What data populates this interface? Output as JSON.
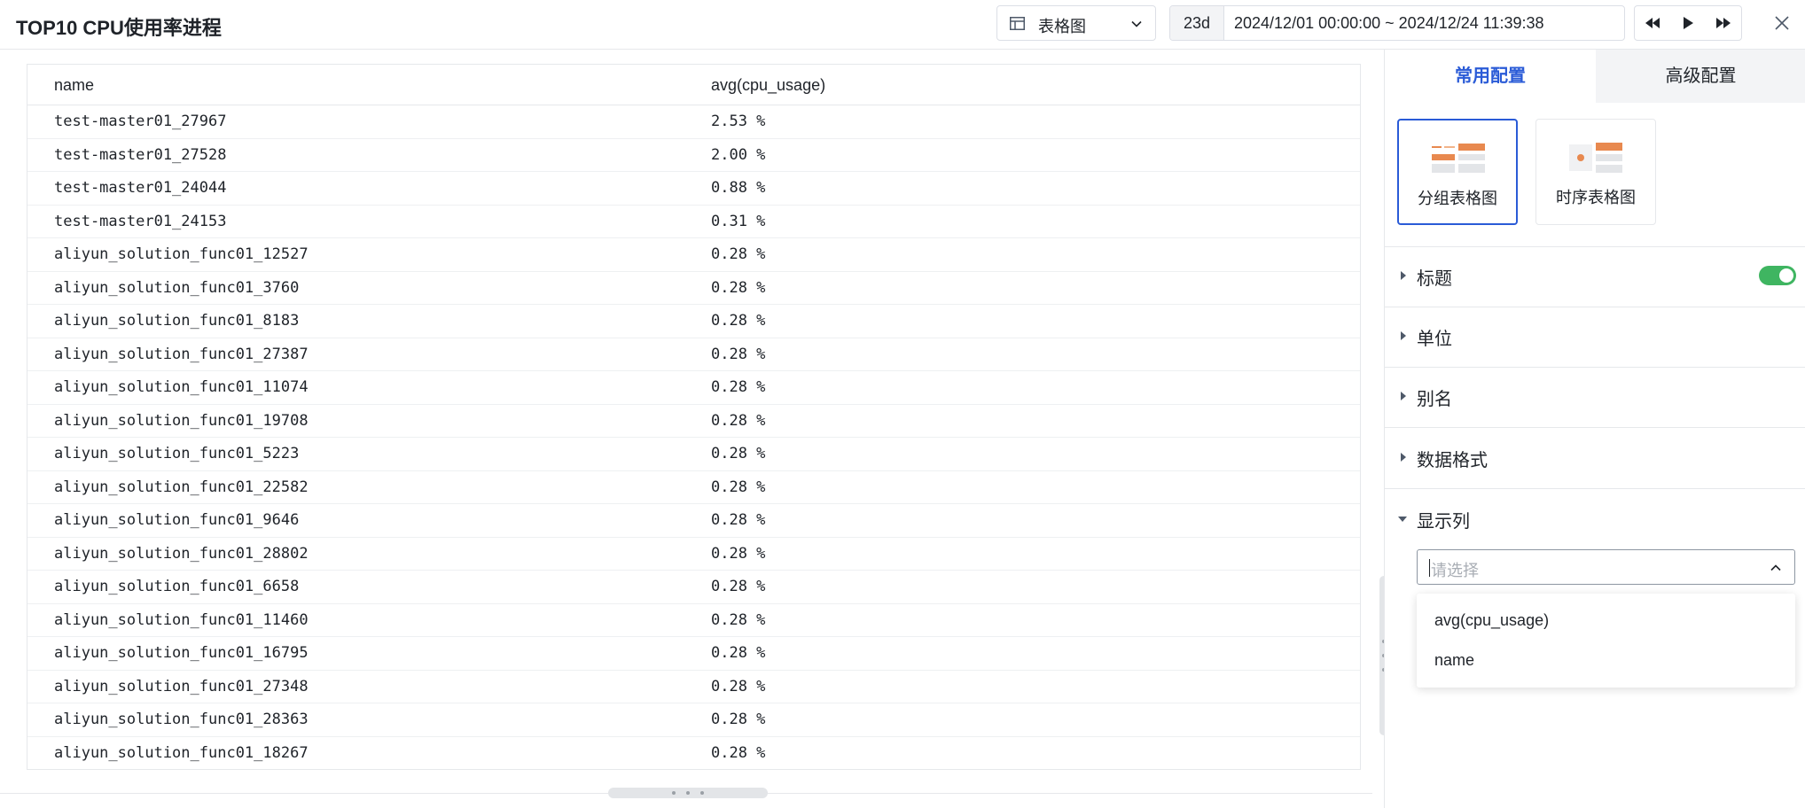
{
  "header": {
    "title": "TOP10 CPU使用率进程",
    "viz_type": "表格图",
    "time_duration": "23d",
    "time_range": "2024/12/01 00:00:00 ~ 2024/12/24 11:39:38"
  },
  "table": {
    "columns": [
      "name",
      "avg(cpu_usage)"
    ],
    "rows": [
      [
        "test-master01_27967",
        "2.53 %"
      ],
      [
        "test-master01_27528",
        "2.00 %"
      ],
      [
        "test-master01_24044",
        "0.88 %"
      ],
      [
        "test-master01_24153",
        "0.31 %"
      ],
      [
        "aliyun_solution_func01_12527",
        "0.28 %"
      ],
      [
        "aliyun_solution_func01_3760",
        "0.28 %"
      ],
      [
        "aliyun_solution_func01_8183",
        "0.28 %"
      ],
      [
        "aliyun_solution_func01_27387",
        "0.28 %"
      ],
      [
        "aliyun_solution_func01_11074",
        "0.28 %"
      ],
      [
        "aliyun_solution_func01_19708",
        "0.28 %"
      ],
      [
        "aliyun_solution_func01_5223",
        "0.28 %"
      ],
      [
        "aliyun_solution_func01_22582",
        "0.28 %"
      ],
      [
        "aliyun_solution_func01_9646",
        "0.28 %"
      ],
      [
        "aliyun_solution_func01_28802",
        "0.28 %"
      ],
      [
        "aliyun_solution_func01_6658",
        "0.28 %"
      ],
      [
        "aliyun_solution_func01_11460",
        "0.28 %"
      ],
      [
        "aliyun_solution_func01_16795",
        "0.28 %"
      ],
      [
        "aliyun_solution_func01_27348",
        "0.28 %"
      ],
      [
        "aliyun_solution_func01_28363",
        "0.28 %"
      ],
      [
        "aliyun_solution_func01_18267",
        "0.28 %"
      ]
    ]
  },
  "panel": {
    "tabs": [
      {
        "label": "常用配置",
        "active": true
      },
      {
        "label": "高级配置",
        "active": false
      }
    ],
    "chart_types": [
      {
        "label": "分组表格图",
        "selected": true,
        "icon": "grouped-table-thumbnail"
      },
      {
        "label": "时序表格图",
        "selected": false,
        "icon": "timeseries-table-thumbnail"
      }
    ],
    "sections": {
      "title": {
        "label": "标题",
        "toggle_on": true
      },
      "unit": {
        "label": "单位"
      },
      "alias": {
        "label": "别名"
      },
      "data_format": {
        "label": "数据格式"
      },
      "display_columns": {
        "label": "显示列",
        "expanded": true
      }
    },
    "column_select": {
      "placeholder": "请选择",
      "options": [
        "avg(cpu_usage)",
        "name"
      ]
    }
  },
  "colors": {
    "accent": "#2a5bd7",
    "toggle_on": "#3fb561",
    "thumbnail_orange": "#e8894f",
    "border": "#e6e8eb"
  }
}
